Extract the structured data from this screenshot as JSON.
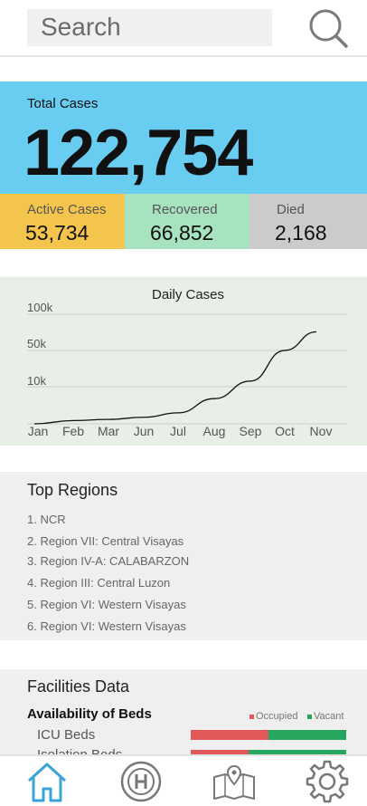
{
  "search": {
    "placeholder": "Search"
  },
  "summary": {
    "total_label": "Total Cases",
    "total_value": "122,754",
    "active_label": "Active Cases",
    "active_value": "53,734",
    "recovered_label": "Recovered",
    "recovered_value": "66,852",
    "died_label": "Died",
    "died_value": "2,168",
    "colors": {
      "total": "#69cdf2",
      "active": "#f4c54d",
      "recovered": "#a8e3c0",
      "died": "#cbcbcb"
    }
  },
  "chart_data": {
    "type": "line",
    "title": "Daily Cases",
    "categories": [
      "Jan",
      "Feb",
      "Mar",
      "Jun",
      "Jul",
      "Aug",
      "Sep",
      "Oct",
      "Nov"
    ],
    "y_ticks": [
      "100k",
      "50k",
      "10k"
    ],
    "values": [
      0,
      3,
      4,
      6,
      10,
      23,
      39,
      67,
      84
    ],
    "ylim": [
      0,
      100
    ],
    "grid": true,
    "series_color": "#111111"
  },
  "regions": {
    "title": "Top Regions",
    "items": [
      "1. NCR",
      "2. Region VII: Central Visayas",
      "3. Region IV-A: CALABARZON",
      "4. Region III: Central Luzon",
      "5. Region VI: Western Visayas",
      "6. Region VI: Western Visayas"
    ]
  },
  "facilities": {
    "title": "Facilities Data",
    "beds_title": "Availability of Beds",
    "legend_occupied": "Occupied",
    "legend_vacant": "Vacant",
    "colors": {
      "occupied": "#e25758",
      "vacant": "#27a660"
    },
    "beds": [
      {
        "label": "ICU Beds",
        "occupied_fraction": 0.5
      },
      {
        "label": "Isolation Beds",
        "occupied_fraction": 0.37
      }
    ]
  },
  "nav": {
    "items": [
      {
        "icon": "home-icon",
        "active": true
      },
      {
        "icon": "hospital-icon",
        "active": false
      },
      {
        "icon": "map-icon",
        "active": false
      },
      {
        "icon": "gear-icon",
        "active": false
      }
    ],
    "active_color": "#3aa3d8",
    "inactive_color": "#777777"
  }
}
